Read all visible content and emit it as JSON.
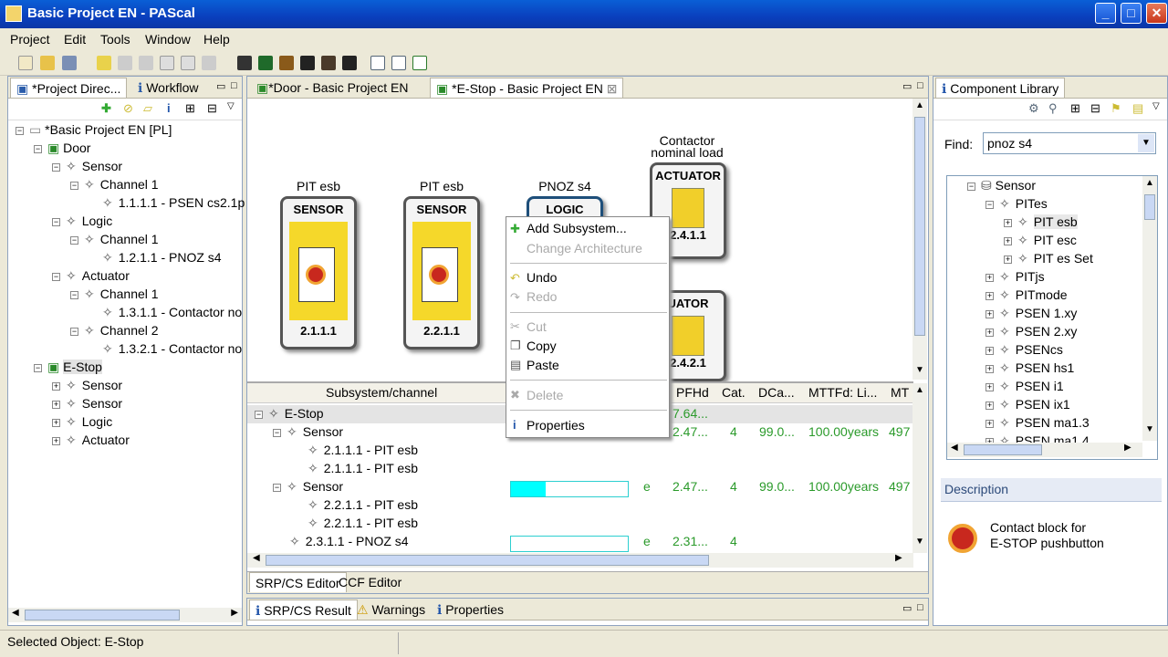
{
  "window": {
    "title": "Basic Project EN - PAScal"
  },
  "menu": [
    "Project",
    "Edit",
    "Tools",
    "Window",
    "Help"
  ],
  "left_panel": {
    "tabs": [
      "*Project Direc...",
      "Workflow"
    ],
    "tree": [
      {
        "label": "*Basic Project EN [PL]"
      },
      {
        "label": "Door"
      },
      {
        "label": "Sensor"
      },
      {
        "label": "Channel 1"
      },
      {
        "label": "1.1.1.1 - PSEN cs2.1p"
      },
      {
        "label": "Logic"
      },
      {
        "label": "Channel 1"
      },
      {
        "label": "1.2.1.1 - PNOZ s4"
      },
      {
        "label": "Actuator"
      },
      {
        "label": "Channel 1"
      },
      {
        "label": "1.3.1.1 - Contactor no"
      },
      {
        "label": "Channel 2"
      },
      {
        "label": "1.3.2.1 - Contactor no"
      },
      {
        "label": "E-Stop"
      },
      {
        "label": "Sensor"
      },
      {
        "label": "Sensor"
      },
      {
        "label": "Logic"
      },
      {
        "label": "Actuator"
      }
    ]
  },
  "editor": {
    "tabs": [
      "*Door - Basic Project EN",
      "*E-Stop - Basic Project EN"
    ],
    "blocks": [
      {
        "top_label": "PIT esb",
        "type": "SENSOR",
        "id": "2.1.1.1"
      },
      {
        "top_label": "PIT esb",
        "type": "SENSOR",
        "id": "2.2.1.1"
      },
      {
        "top_label": "PNOZ s4",
        "type": "LOGIC",
        "id": ""
      },
      {
        "top_label": "Contactor\nnominal load",
        "type": "ACTUATOR",
        "id": "2.4.1.1"
      },
      {
        "top_label": "",
        "type": "UATOR",
        "id": "2.4.2.1"
      }
    ],
    "table": {
      "headers": [
        "Subsystem/channel",
        "PFHd",
        "Cat.",
        "DCa...",
        "MTTFd: Li...",
        "MT"
      ],
      "rows": [
        {
          "name": "E-Stop",
          "pfhd": "7.64...",
          "cat": "",
          "dc": "",
          "mttf": "",
          "mt": ""
        },
        {
          "name": "Sensor",
          "pfhd": "2.47...",
          "cat": "4",
          "dc": "99.0...",
          "mttf": "100.00years",
          "mt": "497"
        },
        {
          "name": "2.1.1.1 - PIT esb",
          "pfhd": "",
          "cat": "",
          "dc": "",
          "mttf": "",
          "mt": ""
        },
        {
          "name": "2.1.1.1 - PIT esb",
          "pfhd": "",
          "cat": "",
          "dc": "",
          "mttf": "",
          "mt": ""
        },
        {
          "name": "Sensor",
          "pl": "e",
          "pfhd": "2.47...",
          "cat": "4",
          "dc": "99.0...",
          "mttf": "100.00years",
          "mt": "497"
        },
        {
          "name": "2.2.1.1 - PIT esb",
          "pfhd": "",
          "cat": "",
          "dc": "",
          "mttf": "",
          "mt": ""
        },
        {
          "name": "2.2.1.1 - PIT esb",
          "pfhd": "",
          "cat": "",
          "dc": "",
          "mttf": "",
          "mt": ""
        },
        {
          "name": "2.3.1.1 - PNOZ s4",
          "pl": "e",
          "pfhd": "2.31...",
          "cat": "4",
          "dc": "",
          "mttf": "",
          "mt": ""
        }
      ],
      "bar_fill": {
        "sensor2": 0.3
      }
    },
    "bottom_tabs": [
      "SRP/CS Editor",
      "CCF Editor"
    ]
  },
  "context_menu": {
    "items": [
      "Add Subsystem...",
      "Change Architecture",
      "Undo",
      "Redo",
      "Cut",
      "Copy",
      "Paste",
      "Delete",
      "Properties"
    ]
  },
  "results_tabs": [
    "SRP/CS Result",
    "Warnings",
    "Properties"
  ],
  "component_library": {
    "title": "Component Library",
    "find_label": "Find:",
    "find_value": "pnoz s4",
    "tree": [
      "Sensor",
      "PITes",
      "PIT esb",
      "PIT esc",
      "PIT es Set",
      "PITjs",
      "PITmode",
      "PSEN 1.xy",
      "PSEN 2.xy",
      "PSENcs",
      "PSEN hs1",
      "PSEN i1",
      "PSEN ix1",
      "PSEN ma1.3",
      "PSEN ma1.4"
    ],
    "description_title": "Description",
    "description_text": "Contact block for\nE-STOP pushbutton"
  },
  "status": {
    "text": "Selected Object: E-Stop"
  },
  "colors": {
    "titlebar": "#0a3fbd",
    "bar_fill": "#00ffff",
    "green_values": "#2a9a2a",
    "sensor_yellow": "#f5d82a"
  }
}
